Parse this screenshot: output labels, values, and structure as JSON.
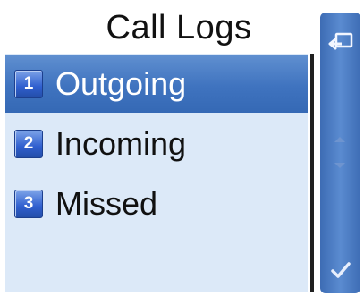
{
  "header": {
    "title": "Call Logs"
  },
  "menu": {
    "items": [
      {
        "number": "1",
        "label": "Outgoing",
        "selected": true
      },
      {
        "number": "2",
        "label": "Incoming",
        "selected": false
      },
      {
        "number": "3",
        "label": "Missed",
        "selected": false
      }
    ]
  },
  "softkeys": {
    "back_icon": "back-return-icon",
    "ok_icon": "checkmark-icon",
    "scroll_up_icon": "arrow-up-icon",
    "scroll_down_icon": "arrow-down-icon"
  },
  "colors": {
    "selection": "#4a7cc6",
    "panel_background": "#dce9f8",
    "sidebar": "#4a7cc4",
    "badge": "#3565cf"
  }
}
